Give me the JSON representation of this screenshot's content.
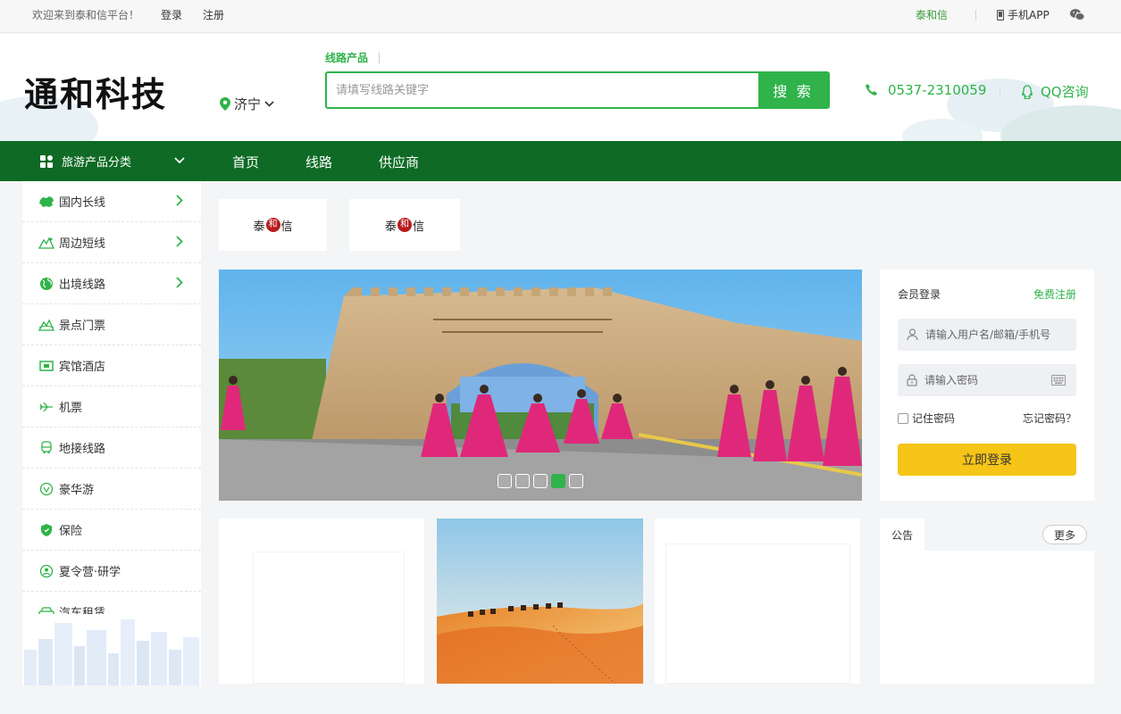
{
  "topbar": {
    "welcome": "欢迎来到泰和信平台！",
    "login": "登录",
    "register": "注册",
    "brand_link": "泰和信",
    "mobile_app": "手机APP"
  },
  "header": {
    "logo": "通和科技",
    "city": "济宁",
    "search_tab": "线路产品",
    "search_placeholder": "请填写线路关键字",
    "search_button": "搜 索",
    "phone": "0537-2310059",
    "qq": "QQ咨询"
  },
  "nav": {
    "category": "旅游产品分类",
    "links": [
      "首页",
      "线路",
      "供应商"
    ]
  },
  "sidebar": {
    "items": [
      {
        "label": "国内长线",
        "icon": "china-map-icon",
        "has_arrow": true
      },
      {
        "label": "周边短线",
        "icon": "mountain-icon",
        "has_arrow": true
      },
      {
        "label": "出境线路",
        "icon": "globe-icon",
        "has_arrow": true
      },
      {
        "label": "景点门票",
        "icon": "scenery-icon",
        "has_arrow": false
      },
      {
        "label": "宾馆酒店",
        "icon": "hotel-icon",
        "has_arrow": false
      },
      {
        "label": "机票",
        "icon": "plane-icon",
        "has_arrow": false
      },
      {
        "label": "地接线路",
        "icon": "bus-icon",
        "has_arrow": false
      },
      {
        "label": "豪华游",
        "icon": "luxury-icon",
        "has_arrow": false
      },
      {
        "label": "保险",
        "icon": "shield-icon",
        "has_arrow": false
      },
      {
        "label": "夏令营·研学",
        "icon": "student-icon",
        "has_arrow": false
      },
      {
        "label": "汽车租赁",
        "icon": "car-icon",
        "has_arrow": false
      }
    ]
  },
  "partners": [
    {
      "logo_text": [
        "泰",
        "和",
        "信"
      ]
    },
    {
      "logo_text": [
        "泰",
        "和",
        "信"
      ]
    }
  ],
  "banner": {
    "slide_count": 5,
    "active_slide": 4
  },
  "login": {
    "title": "会员登录",
    "register_link": "免费注册",
    "username_placeholder": "请输入用户名/邮箱/手机号",
    "password_placeholder": "请输入密码",
    "remember": "记住密码",
    "forgot": "忘记密码？",
    "submit": "立即登录"
  },
  "notice": {
    "tab": "公告",
    "more": "更多"
  },
  "colors": {
    "brand_green": "#2fb34a",
    "nav_green": "#0e6a24",
    "login_yellow": "#f5c518"
  }
}
